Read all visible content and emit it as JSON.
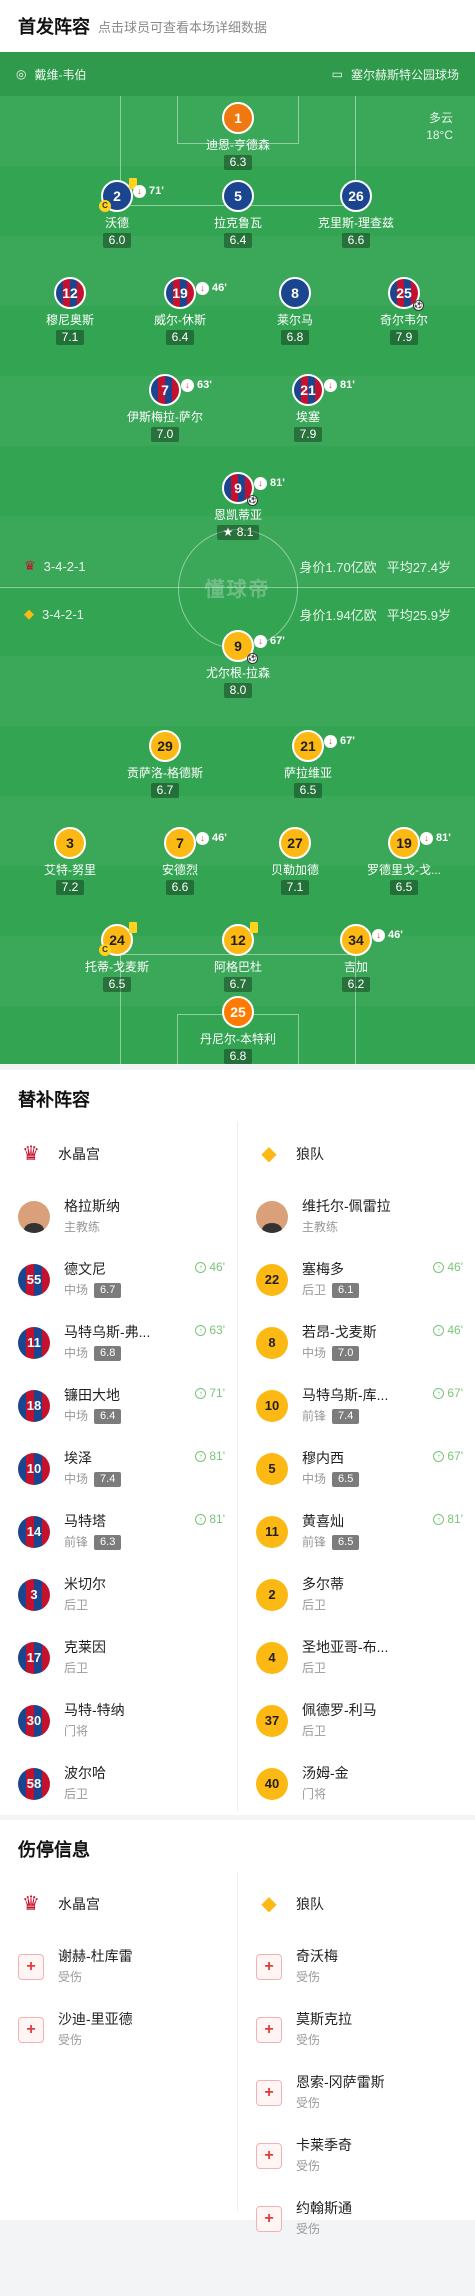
{
  "header": {
    "title": "首发阵容",
    "subtitle": "点击球员可查看本场详细数据"
  },
  "venue": {
    "referee": "戴维-韦伯",
    "stadium": "塞尔赫斯特公园球场"
  },
  "weather": {
    "desc": "多云",
    "temp": "18°C"
  },
  "home_team": {
    "formation": "3-4-2-1",
    "value": "身价1.70亿欧",
    "age": "平均27.4岁"
  },
  "away_team": {
    "formation": "3-4-2-1",
    "value": "身价1.94亿欧",
    "age": "平均25.9岁"
  },
  "watermark": "懂球帝",
  "home_players": [
    {
      "n": "1",
      "name": "迪恩-亨德森",
      "r": "6.3"
    },
    {
      "n": "2",
      "name": "沃德",
      "r": "6.0",
      "sub": "71'"
    },
    {
      "n": "5",
      "name": "拉克鲁瓦",
      "r": "6.4"
    },
    {
      "n": "26",
      "name": "克里斯-理查兹",
      "r": "6.6"
    },
    {
      "n": "12",
      "name": "穆尼奥斯",
      "r": "7.1"
    },
    {
      "n": "19",
      "name": "威尔-休斯",
      "r": "6.4",
      "sub": "46'"
    },
    {
      "n": "8",
      "name": "莱尔马",
      "r": "6.8"
    },
    {
      "n": "25",
      "name": "奇尔韦尔",
      "r": "7.9"
    },
    {
      "n": "7",
      "name": "伊斯梅拉-萨尔",
      "r": "7.0",
      "sub": "63'"
    },
    {
      "n": "21",
      "name": "埃塞",
      "r": "7.9",
      "sub": "81'"
    },
    {
      "n": "9",
      "name": "恩凯蒂亚",
      "r": "8.1",
      "sub": "81'"
    }
  ],
  "away_players": [
    {
      "n": "9",
      "name": "尤尔根-拉森",
      "r": "8.0",
      "sub": "67'"
    },
    {
      "n": "29",
      "name": "贡萨洛-格德斯",
      "r": "6.7"
    },
    {
      "n": "21",
      "name": "萨拉维亚",
      "r": "6.5",
      "sub": "67'"
    },
    {
      "n": "3",
      "name": "艾特-努里",
      "r": "7.2"
    },
    {
      "n": "7",
      "name": "安德烈",
      "r": "6.6",
      "sub": "46'"
    },
    {
      "n": "27",
      "name": "贝勒加德",
      "r": "7.1"
    },
    {
      "n": "19",
      "name": "罗德里戈-戈...",
      "r": "6.5",
      "sub": "81'"
    },
    {
      "n": "24",
      "name": "托蒂-戈麦斯",
      "r": "6.5"
    },
    {
      "n": "12",
      "name": "阿格巴杜",
      "r": "6.7"
    },
    {
      "n": "34",
      "name": "吉加",
      "r": "6.2",
      "sub": "46'"
    },
    {
      "n": "25",
      "name": "丹尼尔-本特利",
      "r": "6.8"
    }
  ],
  "subs": {
    "title": "替补阵容",
    "home_name": "水晶宫",
    "away_name": "狼队",
    "home_coach": {
      "name": "格拉斯纳",
      "role": "主教练"
    },
    "away_coach": {
      "name": "维托尔-佩雷拉",
      "role": "主教练"
    },
    "home": [
      {
        "n": "55",
        "name": "德文尼",
        "pos": "中场",
        "r": "6.7",
        "t": "46'"
      },
      {
        "n": "11",
        "name": "马特乌斯-弗...",
        "pos": "中场",
        "r": "6.8",
        "t": "63'"
      },
      {
        "n": "18",
        "name": "镰田大地",
        "pos": "中场",
        "r": "6.4",
        "t": "71'"
      },
      {
        "n": "10",
        "name": "埃泽",
        "pos": "中场",
        "r": "7.4",
        "t": "81'"
      },
      {
        "n": "14",
        "name": "马特塔",
        "pos": "前锋",
        "r": "6.3",
        "t": "81'"
      },
      {
        "n": "3",
        "name": "米切尔",
        "pos": "后卫"
      },
      {
        "n": "17",
        "name": "克莱因",
        "pos": "后卫"
      },
      {
        "n": "30",
        "name": "马特-特纳",
        "pos": "门将"
      },
      {
        "n": "58",
        "name": "波尔哈",
        "pos": "后卫"
      }
    ],
    "away": [
      {
        "n": "22",
        "name": "塞梅多",
        "pos": "后卫",
        "r": "6.1",
        "t": "46'"
      },
      {
        "n": "8",
        "name": "若昂-戈麦斯",
        "pos": "中场",
        "r": "7.0",
        "t": "46'"
      },
      {
        "n": "10",
        "name": "马特乌斯-库...",
        "pos": "前锋",
        "r": "7.4",
        "t": "67'"
      },
      {
        "n": "5",
        "name": "穆内西",
        "pos": "中场",
        "r": "6.5",
        "t": "67'"
      },
      {
        "n": "11",
        "name": "黄喜灿",
        "pos": "前锋",
        "r": "6.5",
        "t": "81'"
      },
      {
        "n": "2",
        "name": "多尔蒂",
        "pos": "后卫"
      },
      {
        "n": "4",
        "name": "圣地亚哥-布...",
        "pos": "后卫"
      },
      {
        "n": "37",
        "name": "佩德罗-利马",
        "pos": "后卫"
      },
      {
        "n": "40",
        "name": "汤姆-金",
        "pos": "门将"
      }
    ]
  },
  "injuries": {
    "title": "伤停信息",
    "home_name": "水晶宫",
    "away_name": "狼队",
    "home": [
      {
        "name": "谢赫-杜库雷",
        "status": "受伤"
      },
      {
        "name": "沙迪-里亚德",
        "status": "受伤"
      }
    ],
    "away": [
      {
        "name": "奇沃梅",
        "status": "受伤"
      },
      {
        "name": "莫斯克拉",
        "status": "受伤"
      },
      {
        "name": "恩索-冈萨雷斯",
        "status": "受伤"
      },
      {
        "name": "卡莱季奇",
        "status": "受伤"
      },
      {
        "name": "约翰斯通",
        "status": "受伤"
      }
    ]
  }
}
